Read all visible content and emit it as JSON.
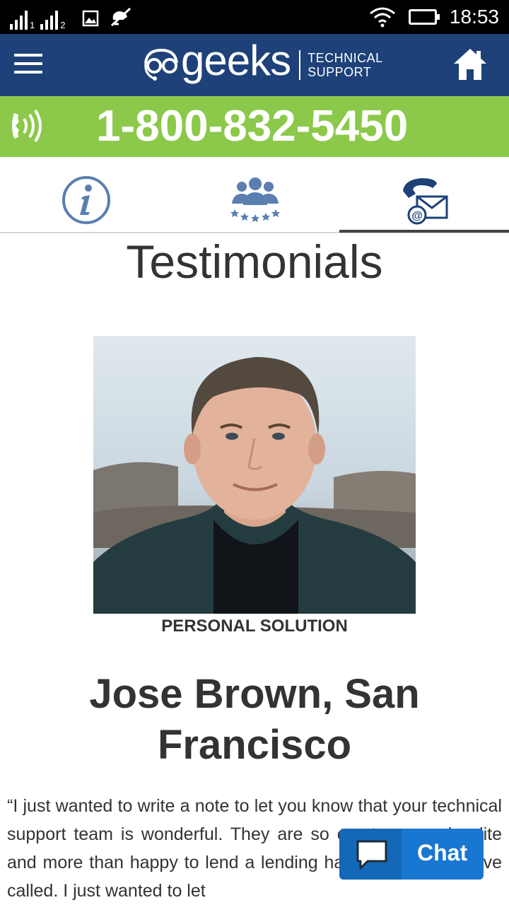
{
  "status_bar": {
    "sim1": "1",
    "sim2": "2",
    "time": "18:53",
    "icons": [
      "signal-icon",
      "signal-icon",
      "image-icon",
      "mute-icon",
      "wifi-icon",
      "battery-icon"
    ]
  },
  "header": {
    "logo_word": "geeks",
    "logo_line1": "TECHNICAL",
    "logo_line2": "SUPPORT",
    "menu_icon": "hamburger-icon",
    "home_icon": "home-icon"
  },
  "phone": {
    "number": "1-800-832-5450",
    "icon": "phone-ring-icon"
  },
  "tabs": [
    {
      "icon": "info-icon",
      "active": false
    },
    {
      "icon": "team-stars-icon",
      "active": false
    },
    {
      "icon": "phone-email-icon",
      "active": true
    }
  ],
  "content": {
    "title": "Testimonials",
    "caption": "PERSONAL SOLUTION",
    "name": "Jose Brown, San Francisco",
    "quote": "“I just wanted to write a note to let you know that your technical support team is wonderful. They are so courteous and polite and more than happy to lend a lending hand whenever I have called. I just wanted to let"
  },
  "chat": {
    "label": "Chat",
    "icon": "chat-bubble-icon"
  },
  "colors": {
    "header_bg": "#1d4178",
    "phone_bar_bg": "#8cc94b",
    "chat_bg": "#1877d1",
    "tab_icon": "#5a7fb0"
  }
}
